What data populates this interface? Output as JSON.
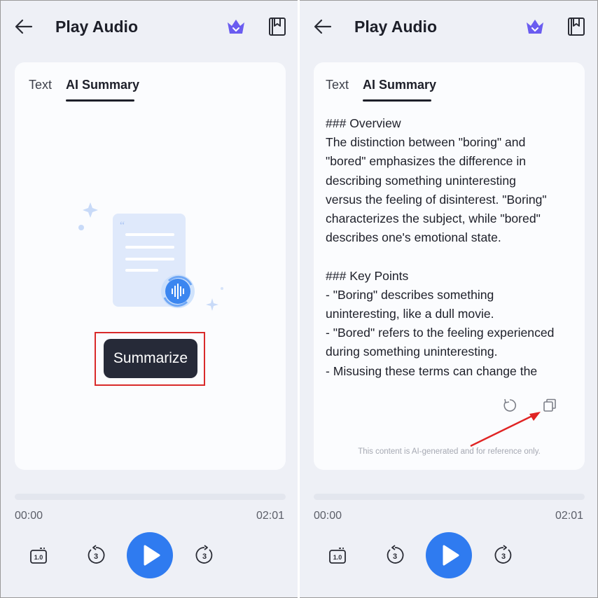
{
  "header": {
    "title": "Play Audio"
  },
  "tabs": {
    "text": "Text",
    "ai_summary": "AI Summary"
  },
  "left": {
    "summarize_label": "Summarize"
  },
  "right": {
    "summary_lines": [
      "### Overview",
      "The distinction between \"boring\" and",
      "\"bored\" emphasizes the difference in",
      "describing something uninteresting",
      "versus the feeling of disinterest. \"Boring\"",
      "characterizes the subject, while \"bored\"",
      "describes one's emotional state.",
      "",
      "### Key Points",
      "- \"Boring\" describes something",
      "uninteresting, like a dull movie.",
      "- \"Bored\" refers to the feeling experienced",
      "during something uninteresting.",
      "- Misusing these terms can change the"
    ],
    "disclaimer": "This content is AI-generated and for reference only."
  },
  "player": {
    "current_time": "00:00",
    "total_time": "02:01",
    "progress": 0,
    "speed_label": "1.0",
    "skip_seconds": "3"
  },
  "icons": {
    "back": "arrow-left-icon",
    "crown": "crown-icon",
    "book": "bookmark-icon",
    "refresh": "refresh-icon",
    "copy": "copy-icon"
  },
  "colors": {
    "accent": "#2f7bf0",
    "crown": "#6a5cf0",
    "button_dark": "#262a38",
    "highlight": "#d92a2a"
  }
}
